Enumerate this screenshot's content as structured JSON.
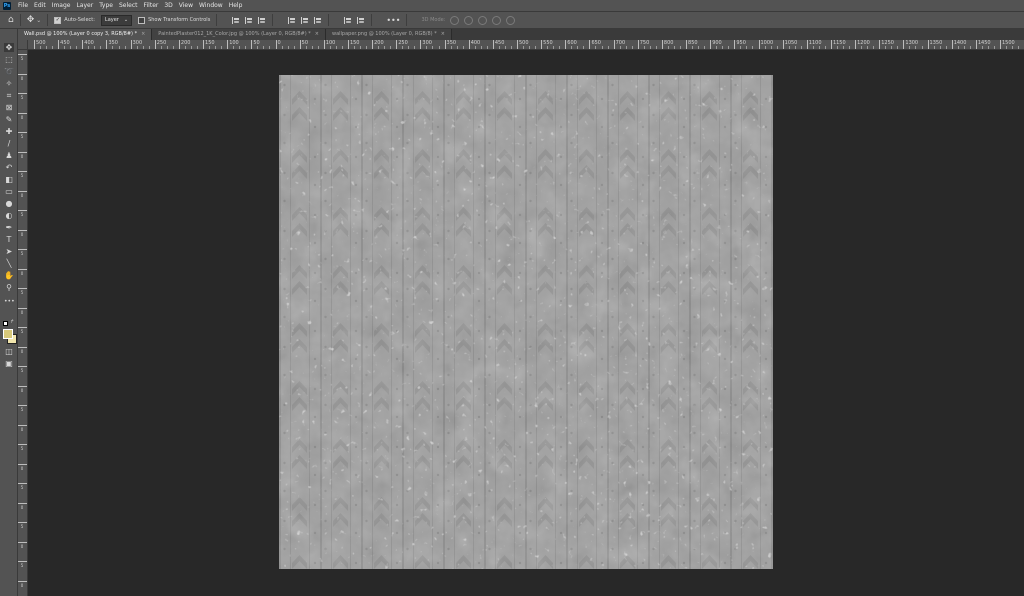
{
  "app": {
    "logo": "Ps"
  },
  "menu": [
    "File",
    "Edit",
    "Image",
    "Layer",
    "Type",
    "Select",
    "Filter",
    "3D",
    "View",
    "Window",
    "Help"
  ],
  "options": {
    "auto_select_label": "Auto-Select:",
    "auto_select_checked": true,
    "layer_dropdown": "Layer",
    "transform_label": "Show Transform Controls",
    "more": "•••",
    "mode_3d": "3D Mode:"
  },
  "tabs": [
    {
      "label": "Wall.psd @ 100% (Layer 0 copy 3, RGB/8#) *",
      "active": true
    },
    {
      "label": "PaintedPlaster012_1K_Color.jpg @ 100% (Layer 0, RGB/8#) *",
      "active": false
    },
    {
      "label": "wallpaper.png @ 100% (Layer 0, RGB/8) *",
      "active": false
    }
  ],
  "ruler": {
    "top_labels": [
      "500",
      "450",
      "400",
      "350",
      "300",
      "250",
      "200",
      "150",
      "100",
      "50",
      "0",
      "50",
      "100",
      "150",
      "200",
      "250",
      "300",
      "350",
      "400",
      "450",
      "500",
      "550",
      "600",
      "650",
      "700",
      "750",
      "800",
      "850",
      "900",
      "950",
      "1000",
      "1050",
      "1100",
      "1150",
      "1200",
      "1250",
      "1300",
      "1350",
      "1400",
      "1450",
      "1500"
    ],
    "left_labels": [
      "5",
      "0",
      "5",
      "0",
      "5",
      "0",
      "5",
      "0",
      "5",
      "0",
      "5",
      "0",
      "5",
      "0",
      "5",
      "0",
      "5",
      "0",
      "5",
      "0",
      "5",
      "0",
      "5",
      "0",
      "5",
      "0",
      "5",
      "0"
    ]
  },
  "tools": [
    "move-tool",
    "marquee-tool",
    "lasso-tool",
    "magic-wand-tool",
    "crop-tool",
    "frame-tool",
    "eyedropper-tool",
    "healing-brush-tool",
    "brush-tool",
    "clone-stamp-tool",
    "history-brush-tool",
    "eraser-tool",
    "gradient-tool",
    "blur-tool",
    "dodge-tool",
    "pen-tool",
    "type-tool",
    "path-selection-tool",
    "line-tool",
    "hand-tool",
    "zoom-tool",
    "more-tools"
  ],
  "colors": {
    "foreground": "#d8c97a",
    "background": "#f2e6ad",
    "canvas_base": "#9d9d9d",
    "panel": "#535353",
    "workspace": "#282828"
  }
}
